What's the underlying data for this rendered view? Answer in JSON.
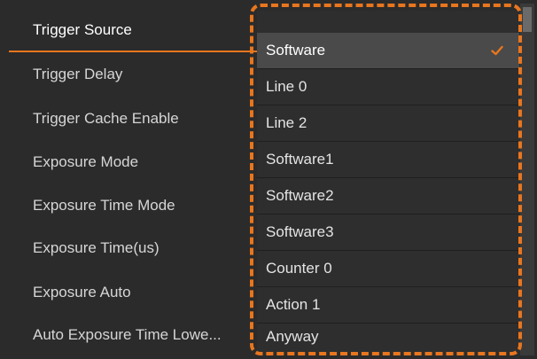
{
  "properties": [
    {
      "label": "Trigger Source"
    },
    {
      "label": "Trigger Delay"
    },
    {
      "label": "Trigger Cache Enable"
    },
    {
      "label": "Exposure Mode"
    },
    {
      "label": "Exposure Time Mode"
    },
    {
      "label": "Exposure Time(us)"
    },
    {
      "label": "Exposure Auto"
    },
    {
      "label": "Auto Exposure Time Lowe..."
    }
  ],
  "dropdown": {
    "selected": "Software",
    "options": [
      {
        "label": "Software"
      },
      {
        "label": "Line 0"
      },
      {
        "label": "Line 2"
      },
      {
        "label": "Software1"
      },
      {
        "label": "Software2"
      },
      {
        "label": "Software3"
      },
      {
        "label": "Counter 0"
      },
      {
        "label": "Action 1"
      },
      {
        "label": "Anyway"
      }
    ]
  },
  "colors": {
    "accent": "#e8761e",
    "background": "#2b2b2b",
    "selected_row": "#4a4a4a",
    "text": "#d6d6d6"
  },
  "icons": {
    "selected_marker": "checkmark-icon"
  }
}
